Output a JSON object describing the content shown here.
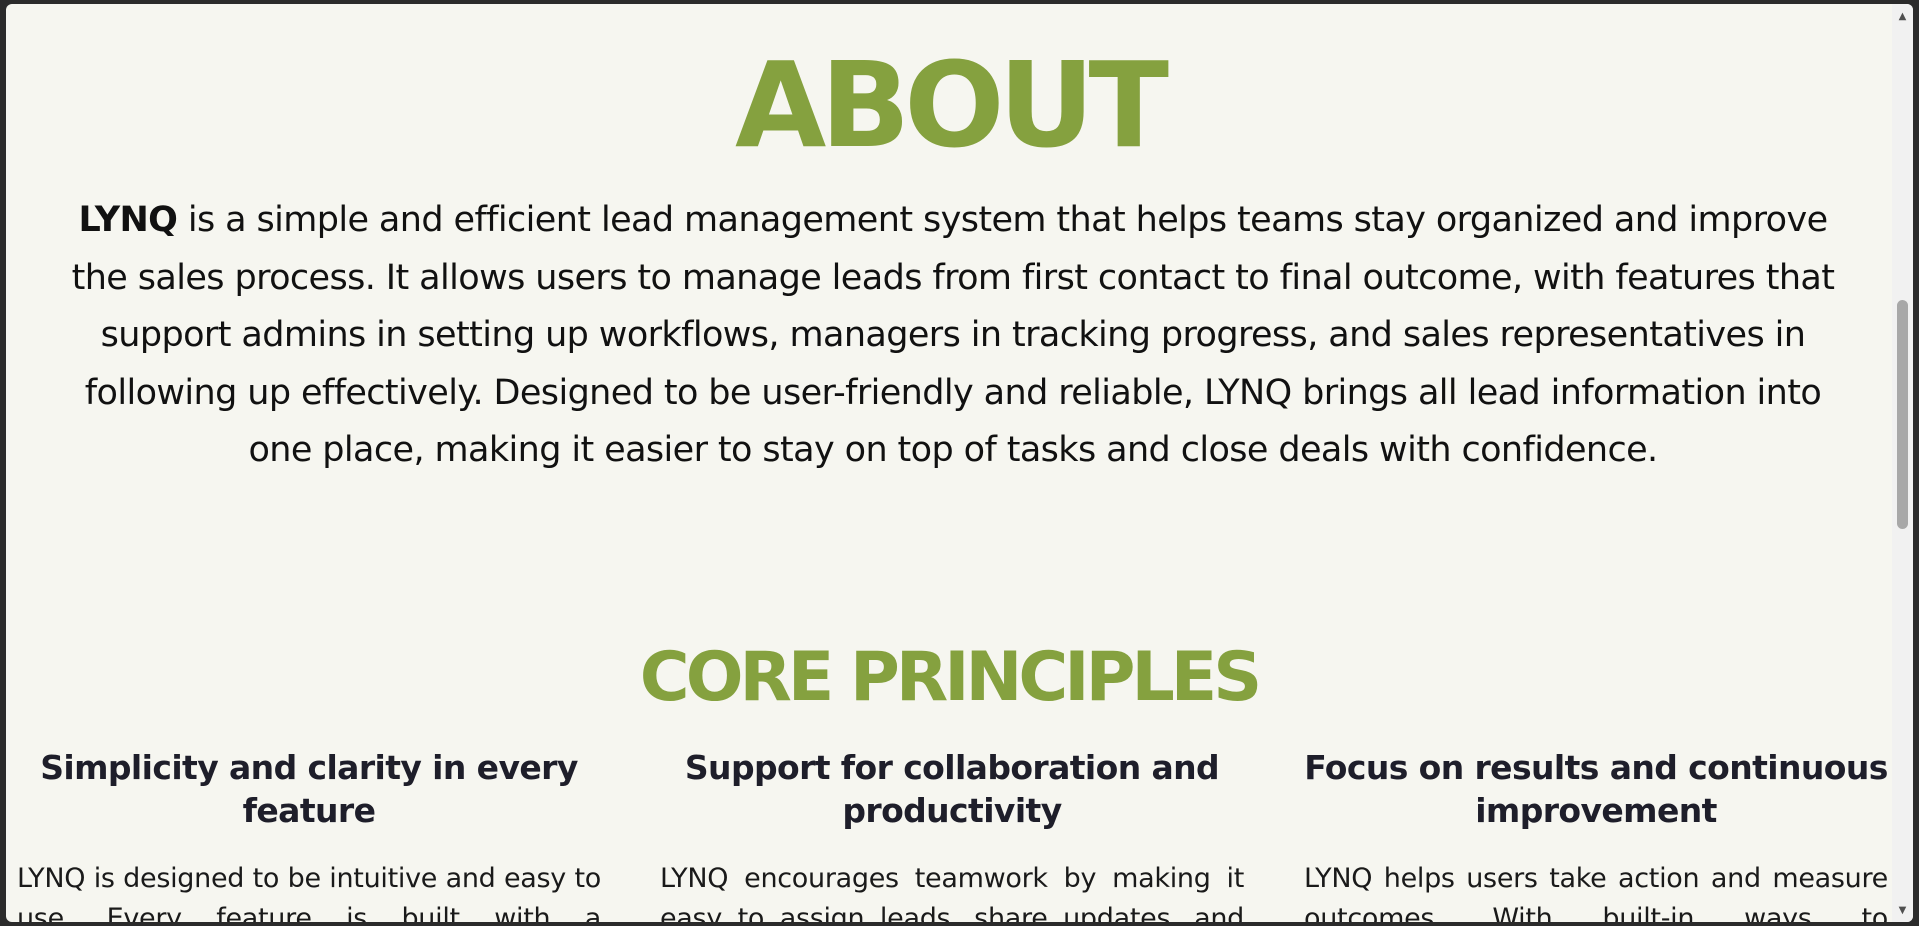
{
  "about": {
    "title": "ABOUT",
    "brand": "LYNQ",
    "description": " is a simple and efficient lead management system that helps teams stay organized and improve the sales process. It allows users to manage leads from first contact to final outcome, with features that support admins in setting up workflows, managers in tracking progress, and sales representatives in following up effectively. Designed to be user-friendly and reliable, LYNQ brings all lead information into one place, making it easier to stay on top of tasks and close deals with confidence."
  },
  "principles": {
    "title": "CORE PRINCIPLES",
    "items": [
      {
        "heading": "Simplicity and clarity in every feature",
        "text": "LYNQ is designed to be intuitive and easy to use. Every feature is built with a"
      },
      {
        "heading": "Support for collaboration and productivity",
        "text": "LYNQ encourages teamwork by making it easy to assign leads, share updates, and"
      },
      {
        "heading": "Focus on results and continuous improvement",
        "text": "LYNQ helps users take action and measure outcomes. With built-in ways to"
      }
    ]
  },
  "scrollbar": {
    "up_icon": "triangle-up-icon",
    "down_icon": "triangle-down-icon",
    "position_fraction": 0.39
  },
  "colors": {
    "accent": "#85a13f",
    "background": "#f6f6f0",
    "text": "#111111"
  }
}
